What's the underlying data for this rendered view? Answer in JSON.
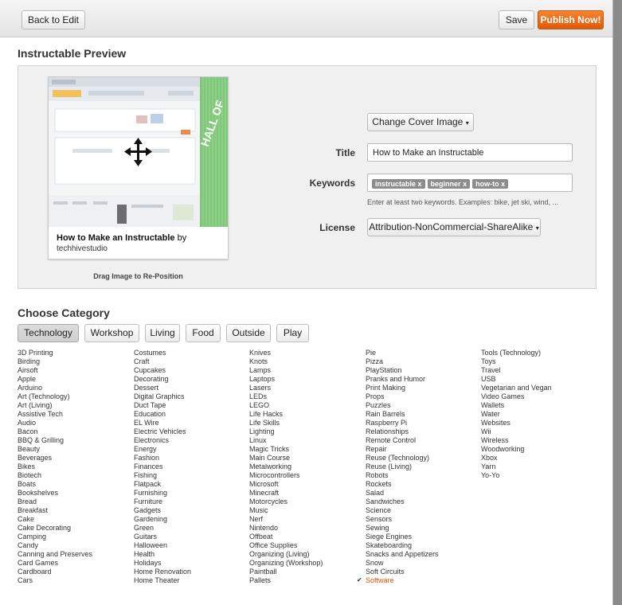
{
  "toolbar": {
    "back_label": "Back to Edit",
    "save_label": "Save",
    "publish_label": "Publish Now!"
  },
  "preview": {
    "heading": "Instructable Preview",
    "card_title": "How to Make an Instructable",
    "card_by": "by",
    "card_author": "techhivestudio",
    "drag_hint": "Drag Image to Re-Position",
    "thumb_logo": "instructables",
    "thumb_side_text": "HALL OF"
  },
  "form": {
    "change_cover_label": "Change Cover Image",
    "title_label": "Title",
    "title_value": "How to Make an Instructable",
    "keywords_label": "Keywords",
    "keywords": [
      "instructable",
      "beginner",
      "how-to"
    ],
    "keywords_hint": "Enter at least two keywords. Examples: bike, jet ski, wind, ...",
    "license_label": "License",
    "license_value": "Attribution-NonCommercial-ShareAlike"
  },
  "category": {
    "heading": "Choose Category",
    "tabs": [
      "Technology",
      "Workshop",
      "Living",
      "Food",
      "Outside",
      "Play"
    ],
    "active_tab": "Technology",
    "selected": "Software",
    "columns": [
      [
        "3D Printing",
        "Birding",
        "Airsoft",
        "Apple",
        "Arduino",
        "Art (Technology)",
        "Art (Living)",
        "Assistive Tech",
        "Audio",
        "Bacon",
        "BBQ & Grilling",
        "Beauty",
        "Beverages",
        "Bikes",
        "Biotech",
        "Boats",
        "Bookshelves",
        "Bread",
        "Breakfast",
        "Cake",
        "Cake Decorating",
        "Camping",
        "Candy",
        "Canning and Preserves",
        "Card Games",
        "Cardboard",
        "Cars"
      ],
      [
        "Costumes",
        "Craft",
        "Cupcakes",
        "Decorating",
        "Dessert",
        "Digital Graphics",
        "Duct Tape",
        "Education",
        "EL Wire",
        "Electric Vehicles",
        "Electronics",
        "Energy",
        "Fashion",
        "Finances",
        "Fishing",
        "Flatpack",
        "Furnishing",
        "Furniture",
        "Gadgets",
        "Gardening",
        "Green",
        "Guitars",
        "Halloween",
        "Health",
        "Holidays",
        "Home Renovation",
        "Home Theater"
      ],
      [
        "Knives",
        "Knots",
        "Lamps",
        "Laptops",
        "Lasers",
        "LEDs",
        "LEGO",
        "Life Hacks",
        "Life Skills",
        "Lighting",
        "Linux",
        "Magic Tricks",
        "Main Course",
        "Metalworking",
        "Microcontrollers",
        "Microsoft",
        "Minecraft",
        "Motorcycles",
        "Music",
        "Nerf",
        "Nintendo",
        "Offbeat",
        "Office Supplies",
        "Organizing (Living)",
        "Organizing (Workshop)",
        "Paintball",
        "Pallets"
      ],
      [
        "Pie",
        "Pizza",
        "PlayStation",
        "Pranks and Humor",
        "Print Making",
        "Props",
        "Puzzles",
        "Rain Barrels",
        "Raspberry Pi",
        "Relationships",
        "Remote Control",
        "Repair",
        "Reuse (Technology)",
        "Reuse (Living)",
        "Robots",
        "Rockets",
        "Salad",
        "Sandwiches",
        "Science",
        "Sensors",
        "Sewing",
        "Siege Engines",
        "Skateboarding",
        "Snacks and Appetizers",
        "Snow",
        "Soft Circuits",
        "Software"
      ],
      [
        "Tools (Technology)",
        "Toys",
        "Travel",
        "USB",
        "Vegetarian and Vegan",
        "Video Games",
        "Wallets",
        "Water",
        "Websites",
        "Wii",
        "Wireless",
        "Woodworking",
        "Xbox",
        "Yarn",
        "Yo-Yo"
      ]
    ]
  },
  "colors": {
    "accent": "#e2590a",
    "selected_text": "#e0500a",
    "thumb_green": "#7fc87a"
  }
}
